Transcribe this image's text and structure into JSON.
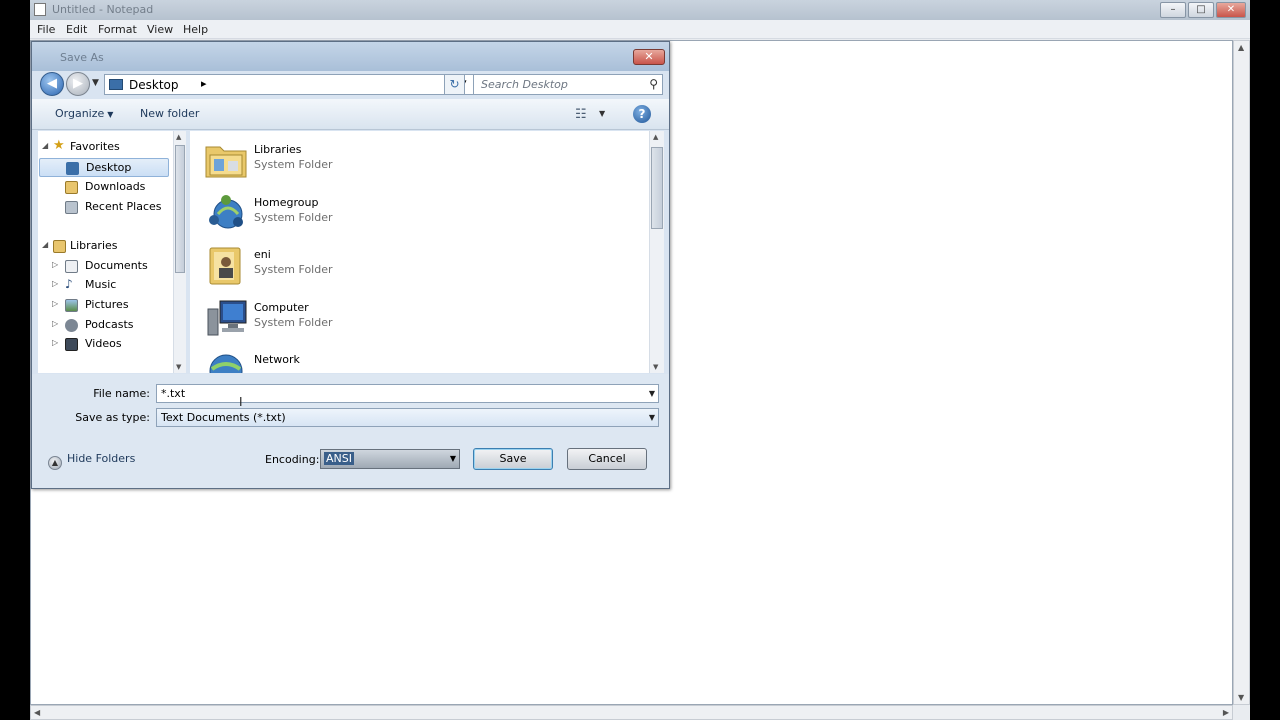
{
  "notepad": {
    "title": "Untitled - Notepad",
    "controls": {
      "minimize": "–",
      "maximize": "□",
      "close": "✕"
    },
    "menu": [
      "File",
      "Edit",
      "Format",
      "View",
      "Help"
    ]
  },
  "dialog": {
    "title": "Save As",
    "close": "✕",
    "address": {
      "location": "Desktop",
      "chevron": "▸",
      "dropdown": "▾"
    },
    "search": {
      "placeholder": "Search Desktop"
    },
    "toolbar": {
      "organize": "Organize",
      "new_folder": "New folder"
    },
    "favorites": {
      "header": "Favorites",
      "items": [
        "Desktop",
        "Downloads",
        "Recent Places"
      ]
    },
    "libraries": {
      "header": "Libraries",
      "items": [
        "Documents",
        "Music",
        "Pictures",
        "Podcasts",
        "Videos"
      ]
    },
    "files": [
      {
        "name": "Libraries",
        "type": "System Folder",
        "icon": "libraries-folder-icon"
      },
      {
        "name": "Homegroup",
        "type": "System Folder",
        "icon": "homegroup-icon"
      },
      {
        "name": "eni",
        "type": "System Folder",
        "icon": "user-folder-icon"
      },
      {
        "name": "Computer",
        "type": "System Folder",
        "icon": "computer-icon"
      },
      {
        "name": "Network",
        "type": "",
        "icon": "network-icon"
      }
    ],
    "file_name": {
      "label": "File name:",
      "value": "*.txt"
    },
    "save_as_type": {
      "label": "Save as type:",
      "value": "Text Documents (*.txt)"
    },
    "hide_folders": "Hide Folders",
    "encoding": {
      "label": "Encoding:",
      "value": "ANSI"
    },
    "buttons": {
      "save": "Save",
      "cancel": "Cancel"
    }
  },
  "colors": {
    "dialog_frame": "#d9e4f1",
    "selection": "#cbdff5",
    "accent": "#1e395b"
  }
}
